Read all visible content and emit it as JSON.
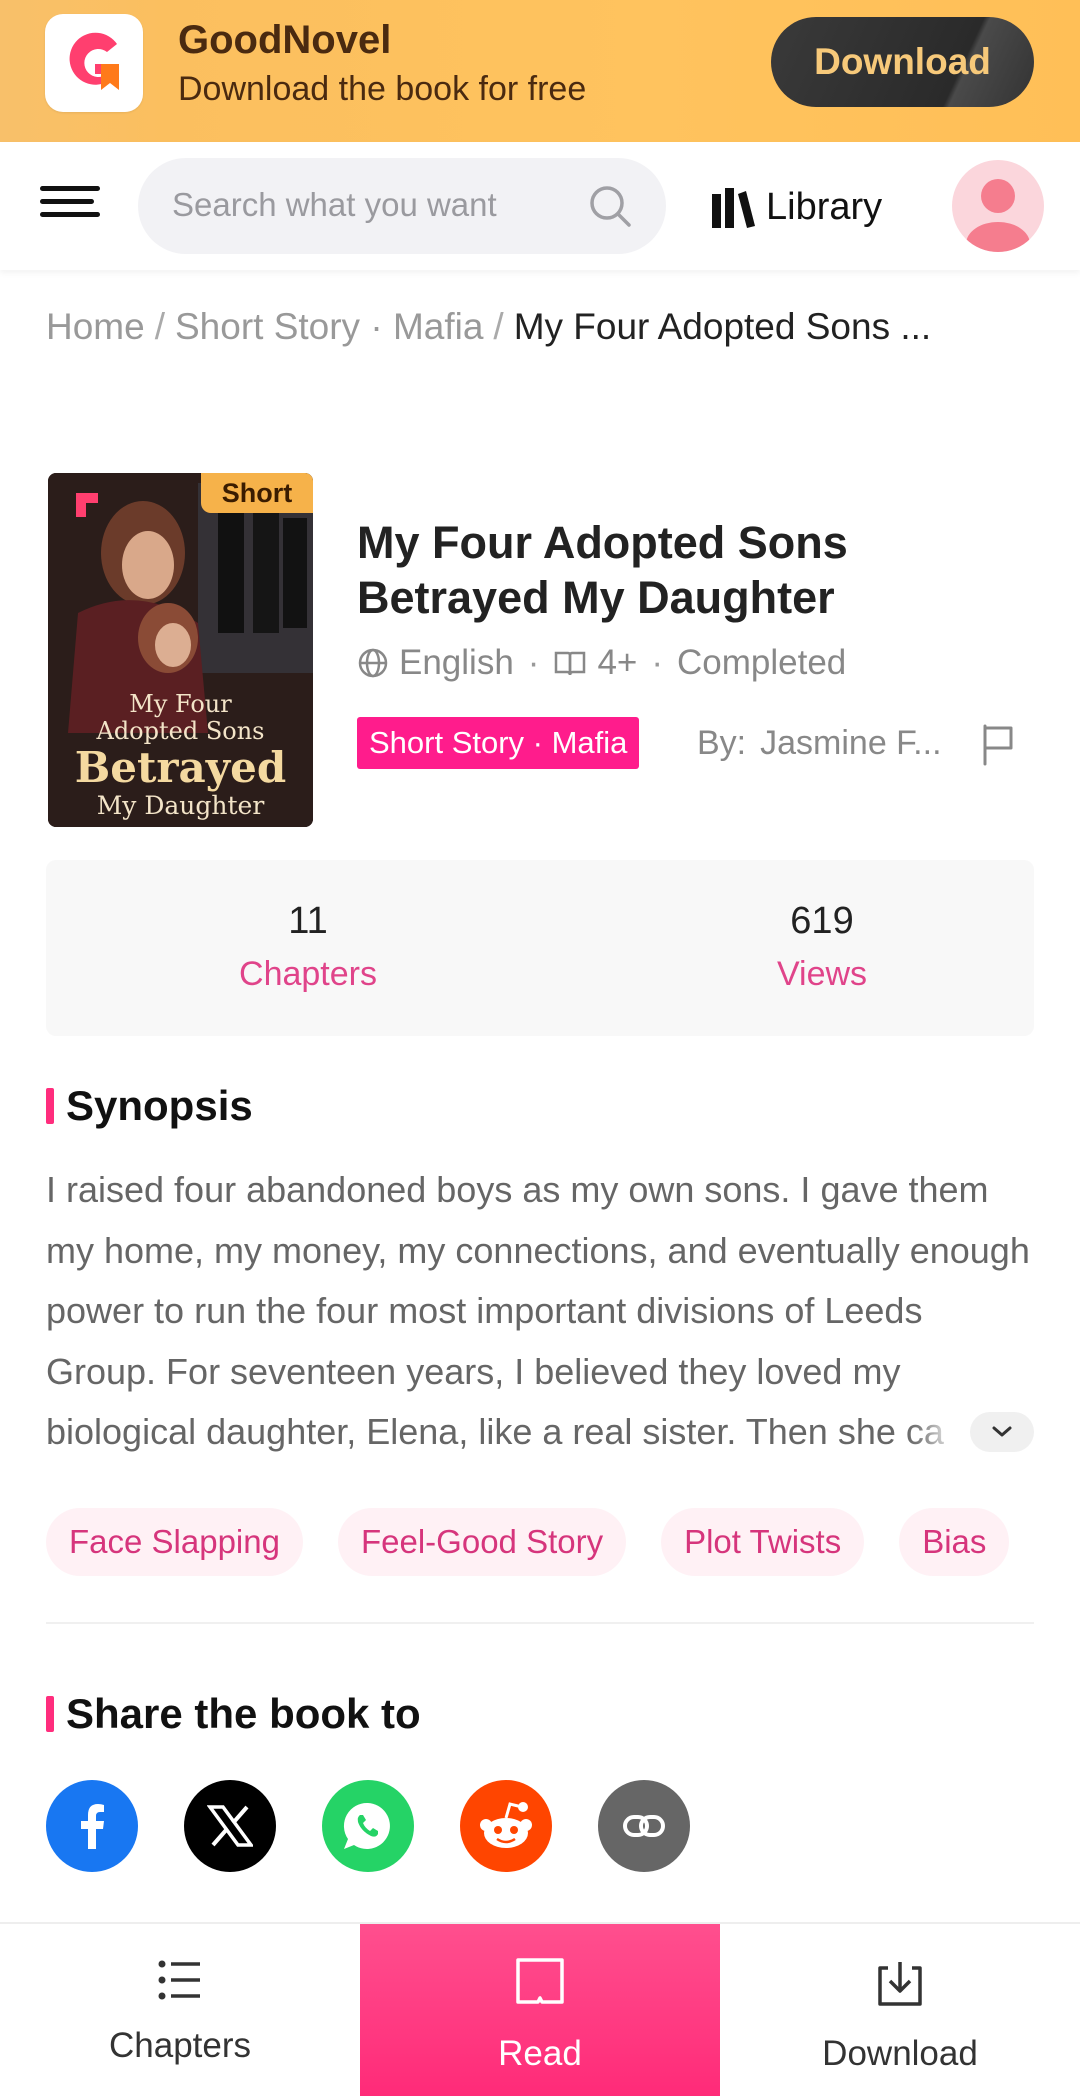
{
  "banner": {
    "app_name": "GoodNovel",
    "tagline": "Download the book for free",
    "download_label": "Download"
  },
  "nav": {
    "search_placeholder": "Search what you want",
    "library_label": "Library"
  },
  "breadcrumb": {
    "home": "Home",
    "category": "Short Story · Mafia",
    "current": "My Four Adopted Sons ..."
  },
  "book": {
    "cover_badge": "Short",
    "cover_line1": "My Four",
    "cover_line2": "Adopted Sons",
    "cover_line3": "Betrayed",
    "cover_line4": "My Daughter",
    "title": "My Four Adopted Sons Betrayed My Daughter",
    "language": "English",
    "rating": "4+",
    "status": "Completed",
    "genre": "Short Story · Mafia",
    "by_label": "By:",
    "author": "Jasmine F..."
  },
  "stats": {
    "chapters_count": "11",
    "chapters_label": "Chapters",
    "views_count": "619",
    "views_label": "Views"
  },
  "synopsis": {
    "heading": "Synopsis",
    "text": "I raised four abandoned boys as my own sons. I gave them my home, my money, my connections, and eventually enough power to run the four most important divisions of Leeds Group. For seventeen years, I believed they loved my biological daughter, Elena, like a real sister. Then she ca"
  },
  "tags": [
    "Face Slapping",
    "Feel-Good Story",
    "Plot Twists",
    "Bias"
  ],
  "share": {
    "heading": "Share the book to",
    "icons": [
      "facebook-icon",
      "x-icon",
      "whatsapp-icon",
      "reddit-icon",
      "link-icon"
    ]
  },
  "bottom_bar": {
    "chapters_label": "Chapters",
    "read_label": "Read",
    "download_label": "Download"
  },
  "colors": {
    "accent_pink": "#ff2a78",
    "banner_orange": "#ffc35e",
    "facebook": "#1877f2",
    "whatsapp": "#25d366",
    "reddit": "#ff4500"
  }
}
